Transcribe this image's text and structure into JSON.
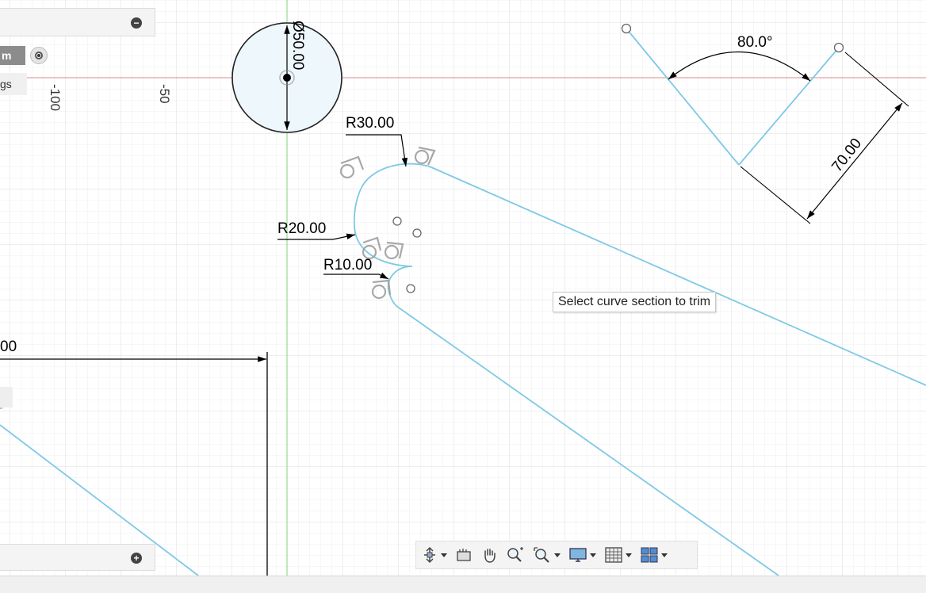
{
  "browser_panel": {
    "unit_label": "m",
    "settings_label": "gs"
  },
  "axis_labels": {
    "x_minus_100": "-100",
    "x_minus_50": "-50"
  },
  "dimensions": {
    "diameter": "Ø50.00",
    "r30": "R30.00",
    "r20": "R20.00",
    "r10": "R10.00",
    "angle": "80.0°",
    "length": "70.00",
    "partial_left": "00"
  },
  "tooltip": {
    "text": "Select curve section to trim"
  },
  "colors": {
    "sketch_line": "#7ec9e6",
    "x_axis": "#d98b8b",
    "y_axis": "#7fd37f",
    "grid_minor": "#ededed",
    "grid_major": "#dcdcdc"
  },
  "nav_toolbar": {
    "items": [
      "orbit-icon",
      "look-at-icon",
      "pan-icon",
      "zoom-icon",
      "fit-icon",
      "display-settings-icon",
      "grid-settings-icon",
      "viewports-icon"
    ]
  }
}
